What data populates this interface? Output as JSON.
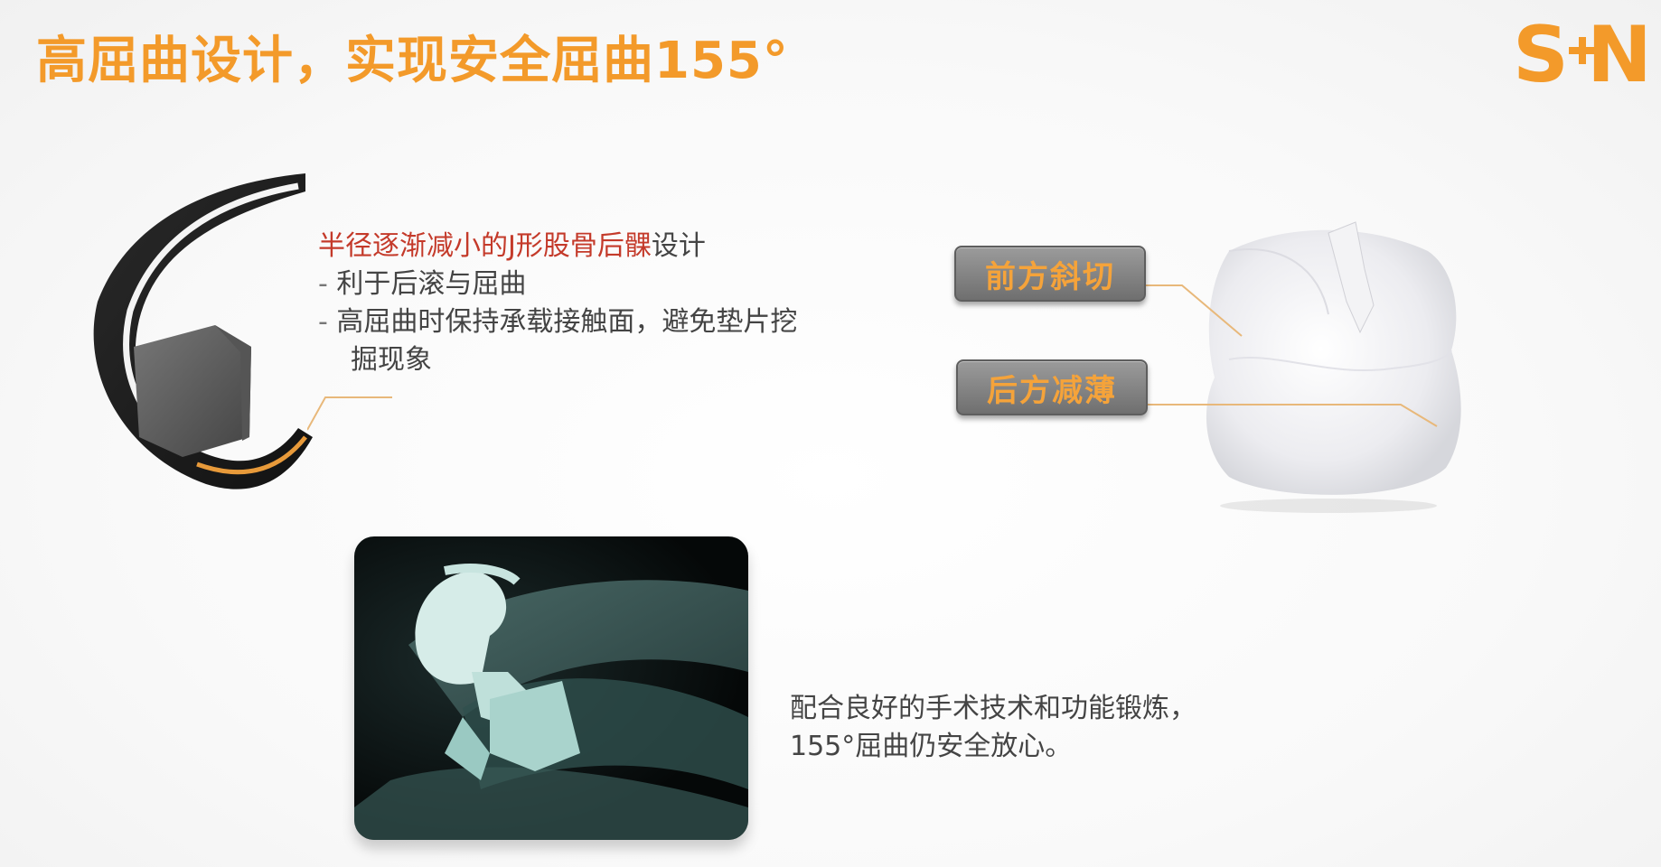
{
  "title": "高屈曲设计，实现安全屈曲155°",
  "logo": {
    "text": "S+N",
    "icon": "smith-nephew-logo",
    "color": "#f39a2a"
  },
  "femur": {
    "icon": "femoral-component-image",
    "bullets": {
      "main_prefix": "半径逐渐减小的J形股骨后髁",
      "main_suffix": "设计",
      "sub1_dash": "-",
      "sub1": " 利于后滚与屈曲",
      "sub2_dash": "-",
      "sub2_line1": " 高屈曲时保持承载接触面，避免垫片挖",
      "sub2_line2": "掘现象"
    }
  },
  "insert": {
    "icon": "tibial-insert-image",
    "tag1": "前方斜切",
    "tag2": "后方减薄"
  },
  "xray": {
    "icon": "knee-xray-image"
  },
  "caption": {
    "line1": "配合良好的手术技术和功能锻炼，",
    "line2": "155°屈曲仍安全放心。"
  },
  "colors": {
    "accent": "#f39a2a",
    "highlight": "#c43a2a",
    "text": "#444444"
  }
}
